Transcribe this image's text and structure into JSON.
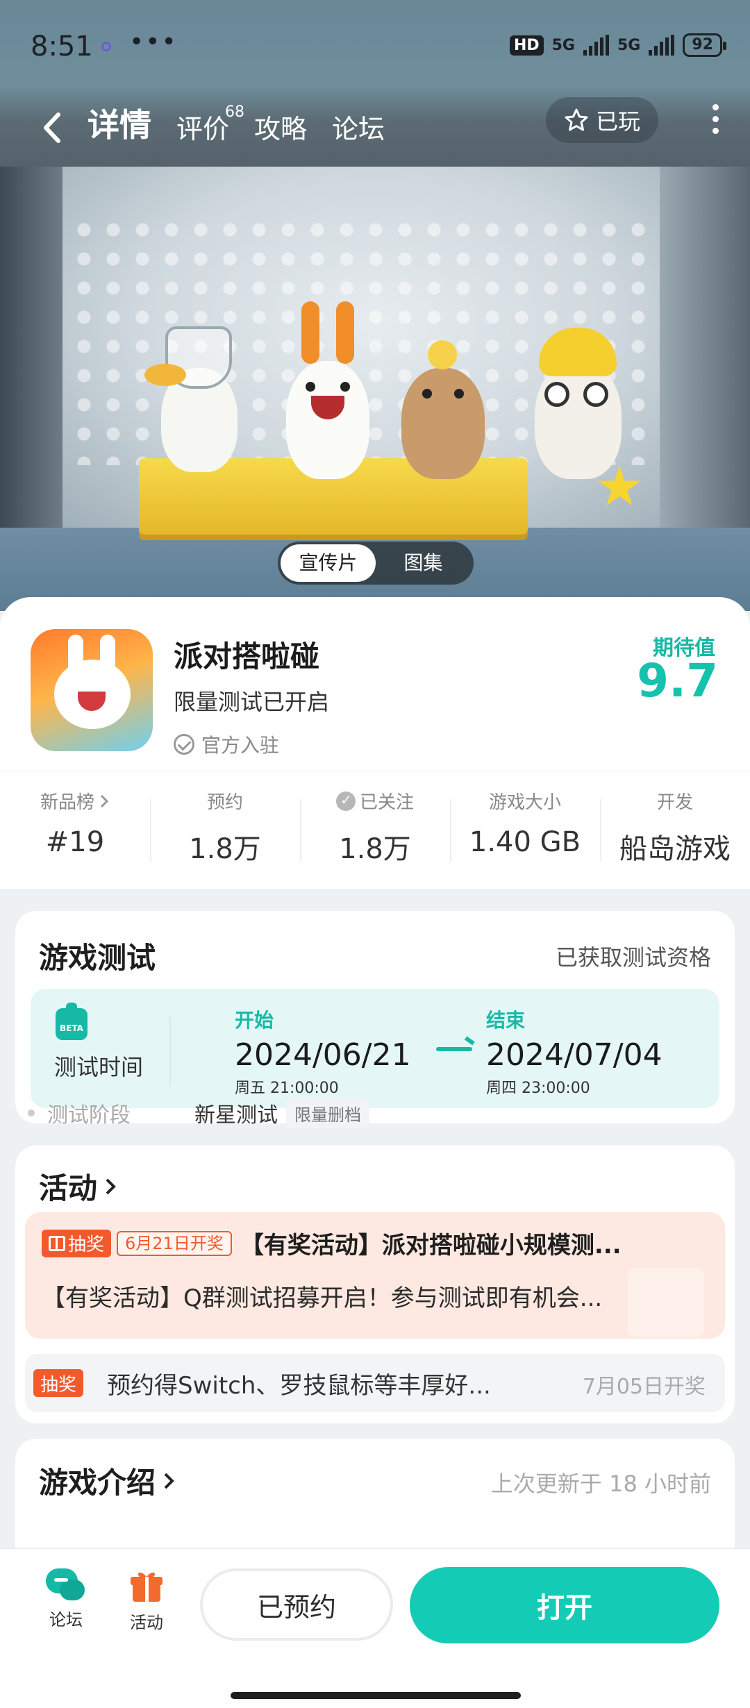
{
  "status_bar": {
    "time": "8:51",
    "more": "•••",
    "hd": "HD",
    "net1": "5G",
    "net2": "5G",
    "battery": "92"
  },
  "nav": {
    "tabs": [
      {
        "label": "详情",
        "active": true
      },
      {
        "label": "评价",
        "badge": "68"
      },
      {
        "label": "攻略"
      },
      {
        "label": "论坛"
      }
    ],
    "played_label": "已玩"
  },
  "banner": {
    "toggle": [
      {
        "label": "宣传片",
        "active": true
      },
      {
        "label": "图集"
      }
    ]
  },
  "game": {
    "title": "派对搭啦碰",
    "subtitle": "限量测试已开启",
    "official": "官方入驻",
    "expect_label": "期待值",
    "expect_score": "9.7"
  },
  "stats": [
    {
      "label": "新品榜",
      "value": "#19",
      "chevron": true
    },
    {
      "label": "预约",
      "value": "1.8万"
    },
    {
      "label": "已关注",
      "value": "1.8万",
      "icon": "heart-check-icon"
    },
    {
      "label": "游戏大小",
      "value": "1.40 GB"
    },
    {
      "label": "开发",
      "value": "船岛游戏"
    }
  ],
  "test": {
    "title": "游戏测试",
    "status": "已获取测试资格",
    "time_label": "测试时间",
    "beta": "BETA",
    "start": {
      "label": "开始",
      "date": "2024/06/21",
      "time": "周五  21:00:00"
    },
    "end": {
      "label": "结束",
      "date": "2024/07/04",
      "time": "周四  23:00:00"
    },
    "stage_label": "测试阶段",
    "stage_value": "新星测试",
    "stage_tag": "限量删档"
  },
  "activity": {
    "title": "活动",
    "item1": {
      "tag": "抽奖",
      "date_tag": "6月21日开奖",
      "title": "【有奖活动】派对搭啦碰小规模测...",
      "desc": "【有奖活动】Q群测试招募开启！参与测试即有机会..."
    },
    "item2": {
      "tag": "抽奖",
      "text": "预约得Switch、罗技鼠标等丰厚好...",
      "when": "7月05日开奖"
    }
  },
  "intro": {
    "title": "游戏介绍",
    "updated": "上次更新于 18 小时前"
  },
  "bottom": {
    "forum_label": "论坛",
    "activity_label": "活动",
    "reserved_label": "已预约",
    "open_label": "打开"
  },
  "colors": {
    "accent": "#16c2ad",
    "lottery": "#f25a2c"
  }
}
